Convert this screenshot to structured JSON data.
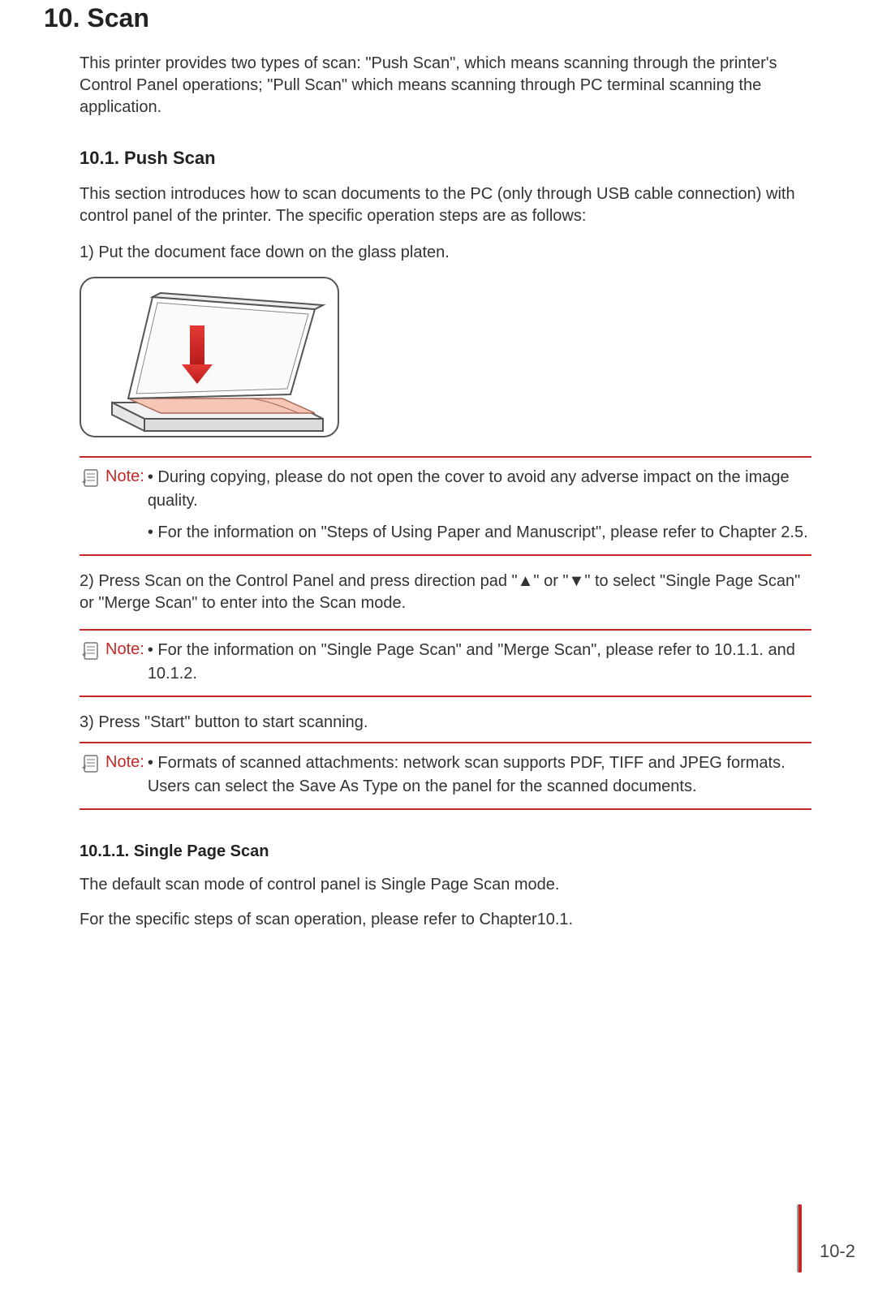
{
  "chapter": {
    "title": "10. Scan",
    "intro": "This printer provides two types of scan: \"Push Scan\", which means scanning through the printer's Control Panel operations; \"Pull Scan\" which means scanning through PC terminal scanning the application."
  },
  "section_10_1": {
    "title": "10.1. Push Scan",
    "intro": "This section introduces how to scan documents to the PC (only through USB cable connection) with control panel of the printer. The specific operation steps are as follows:",
    "step1": "1) Put the document face down on the glass platen.",
    "note1": {
      "label": "Note:",
      "line1": "• During copying, please do not open the cover to avoid any adverse impact on the image quality.",
      "line2": "• For the information on \"Steps of Using Paper and Manuscript\", please refer to Chapter 2.5."
    },
    "step2": "2) Press Scan on the Control Panel and press direction pad \"▲\" or \"▼\" to select \"Single Page Scan\" or \"Merge Scan\" to enter into the Scan mode.",
    "note2": {
      "label": "Note:",
      "line1": "• For the information on \"Single Page Scan\" and \"Merge Scan\", please refer to 10.1.1. and 10.1.2."
    },
    "step3": "3) Press \"Start\" button to start scanning.",
    "note3": {
      "label": "Note:",
      "line1": "• Formats of scanned attachments: network scan supports PDF, TIFF and JPEG formats. Users can select the Save As Type on the panel for the scanned documents."
    }
  },
  "section_10_1_1": {
    "title": "10.1.1. Single Page Scan",
    "para1": "The default scan mode of control panel is Single Page Scan mode.",
    "para2": "For the specific steps of scan operation, please refer to Chapter10.1."
  },
  "footer": {
    "page": "10-2"
  }
}
